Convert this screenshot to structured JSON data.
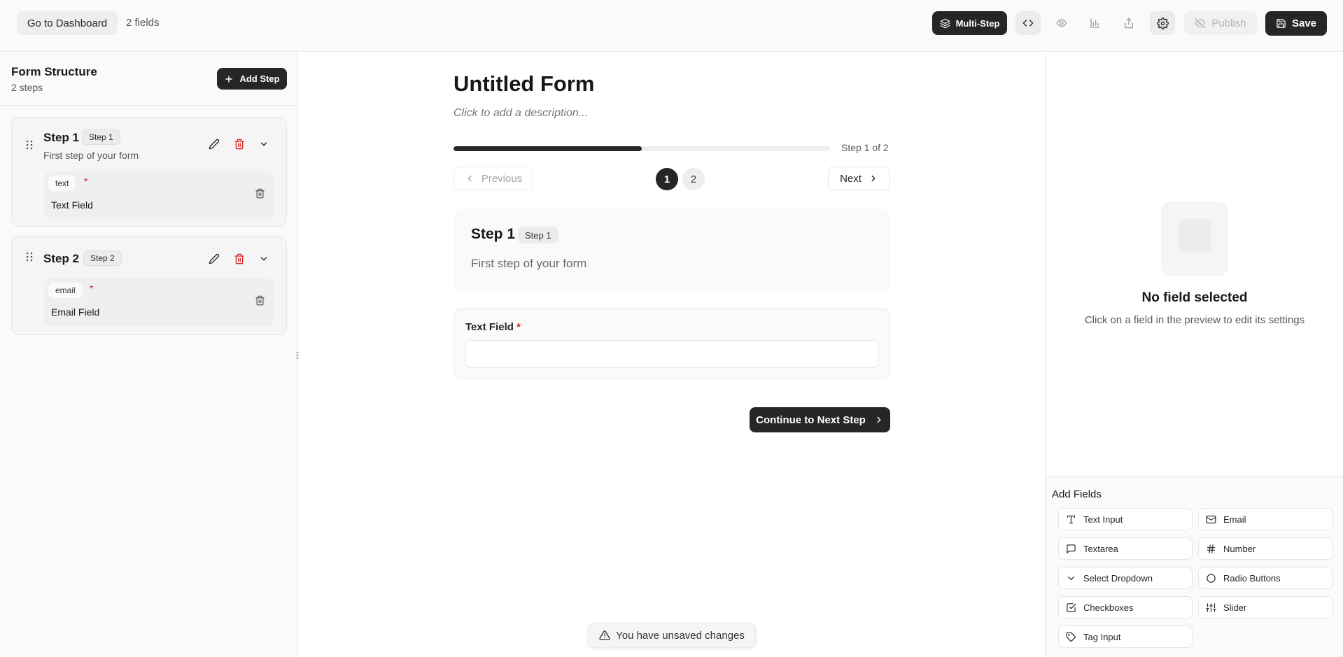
{
  "topbar": {
    "dashboard_label": "Go to Dashboard",
    "field_count": "2 fields",
    "multistep_label": "Multi-Step",
    "publish_label": "Publish",
    "save_label": "Save"
  },
  "sidebar": {
    "title": "Form Structure",
    "subtitle": "2 steps",
    "add_step_label": "Add Step",
    "steps": [
      {
        "name": "Step 1",
        "badge": "Step 1",
        "description": "First step of your form",
        "field": {
          "type": "text",
          "label": "Text Field",
          "required": "*"
        }
      },
      {
        "name": "Step 2",
        "badge": "Step 2",
        "field": {
          "type": "email",
          "label": "Email Field",
          "required": "*"
        }
      }
    ]
  },
  "form": {
    "title": "Untitled Form",
    "description_placeholder": "Click to add a description...",
    "progress_text": "Step 1 of 2",
    "progress_fraction": 0.5,
    "prev_label": "Previous",
    "next_label": "Next",
    "step_numbers": [
      "1",
      "2"
    ],
    "current_step": {
      "title": "Step 1",
      "badge": "Step 1",
      "description": "First step of your form"
    },
    "field": {
      "label": "Text Field",
      "required": "*"
    },
    "continue_label": "Continue to Next Step"
  },
  "toast": {
    "text": "You have unsaved changes"
  },
  "settings": {
    "empty_title": "No field selected",
    "empty_subtitle": "Click on a field in the preview to edit its settings"
  },
  "add_fields": {
    "title": "Add Fields",
    "items": [
      {
        "label": "Text Input",
        "icon": "type-icon"
      },
      {
        "label": "Email",
        "icon": "mail-icon"
      },
      {
        "label": "Textarea",
        "icon": "message-square-icon"
      },
      {
        "label": "Number",
        "icon": "hash-icon"
      },
      {
        "label": "Select Dropdown",
        "icon": "chevron-down-icon"
      },
      {
        "label": "Radio Buttons",
        "icon": "circle-icon"
      },
      {
        "label": "Checkboxes",
        "icon": "check-square-icon"
      },
      {
        "label": "Slider",
        "icon": "sliders-icon"
      },
      {
        "label": "Tag Input",
        "icon": "tag-icon"
      }
    ]
  },
  "colors": {
    "primary": "#262626",
    "danger": "#dc2626",
    "muted_text": "#595959"
  }
}
